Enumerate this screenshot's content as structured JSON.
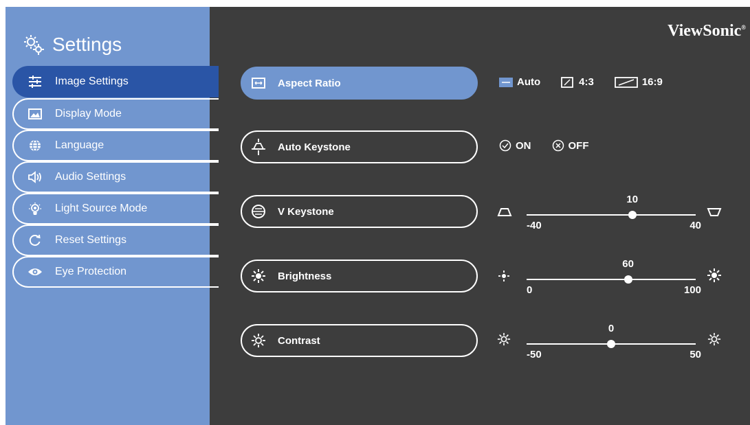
{
  "brand": "ViewSonic",
  "sidebar": {
    "title": "Settings",
    "items": [
      {
        "label": "Image Settings",
        "icon": "sliders-icon",
        "active": true
      },
      {
        "label": "Display Mode",
        "icon": "picture-icon"
      },
      {
        "label": "Language",
        "icon": "globe-icon"
      },
      {
        "label": "Audio Settings",
        "icon": "speaker-icon"
      },
      {
        "label": "Light Source Mode",
        "icon": "lamp-icon"
      },
      {
        "label": "Reset Settings",
        "icon": "reset-icon"
      },
      {
        "label": "Eye Protection",
        "icon": "eye-icon"
      }
    ]
  },
  "options": {
    "aspect_ratio": {
      "label": "Aspect Ratio",
      "choices": [
        "Auto",
        "4:3",
        "16:9"
      ],
      "selected": "Auto"
    },
    "auto_keystone": {
      "label": "Auto Keystone",
      "choices": [
        "ON",
        "OFF"
      ]
    },
    "v_keystone": {
      "label": "V Keystone",
      "value": "10",
      "min": "-40",
      "max": "40",
      "level": 0.625
    },
    "brightness": {
      "label": "Brightness",
      "value": "60",
      "min": "0",
      "max": "100",
      "level": 0.6
    },
    "contrast": {
      "label": "Contrast",
      "value": "0",
      "min": "-50",
      "max": "50",
      "level": 0.5
    }
  },
  "colors": {
    "sidebar_bg": "#7196cf",
    "sidebar_active": "#2a55a6",
    "main_bg": "#3d3d3d"
  }
}
